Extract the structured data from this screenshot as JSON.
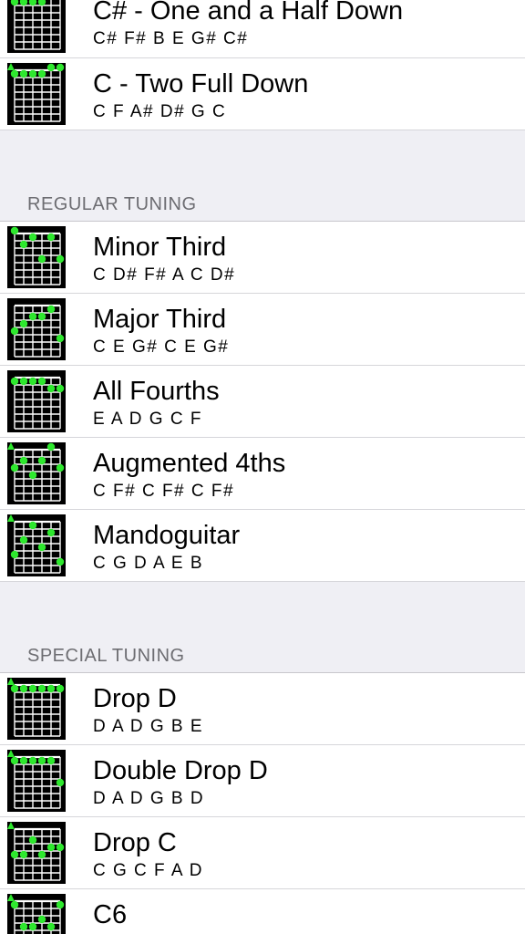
{
  "sections": [
    {
      "header": "",
      "rows": [
        {
          "name": "C# - One and a Half Down",
          "notes": "C# F# B E G# C#",
          "fret": [
            1,
            1,
            1,
            1,
            0,
            0
          ],
          "flag": "none"
        },
        {
          "name": "C - Two Full Down",
          "notes": "C F A# D# G C",
          "fret": [
            1,
            1,
            1,
            1,
            0,
            0
          ],
          "flag": "triangle"
        }
      ]
    },
    {
      "header": "REGULAR TUNING",
      "rows": [
        {
          "name": "Minor Third",
          "notes": "C D# F# A C D#",
          "fret": [
            0,
            2,
            1,
            4,
            1,
            4
          ],
          "flag": "none"
        },
        {
          "name": "Major Third",
          "notes": "C E G# C E G#",
          "fret": [
            4,
            3,
            2,
            2,
            1,
            5
          ],
          "flag": "none"
        },
        {
          "name": "All Fourths",
          "notes": "E A D G C F",
          "fret": [
            1,
            1,
            1,
            1,
            2,
            2
          ],
          "flag": "none"
        },
        {
          "name": "Augmented 4ths",
          "notes": "C F# C F# C F#",
          "fret": [
            3,
            2,
            4,
            2,
            0,
            3
          ],
          "flag": "triangle"
        },
        {
          "name": "Mandoguitar",
          "notes": "C G D A E B",
          "fret": [
            5,
            3,
            1,
            4,
            2,
            6
          ],
          "flag": "triangle"
        }
      ]
    },
    {
      "header": "SPECIAL TUNING",
      "rows": [
        {
          "name": "Drop D",
          "notes": "D A D G B E",
          "fret": [
            1,
            1,
            1,
            1,
            1,
            1
          ],
          "flag": "triangle"
        },
        {
          "name": "Double Drop D",
          "notes": "D A D G B D",
          "fret": [
            1,
            1,
            1,
            1,
            1,
            4
          ],
          "flag": "triangle"
        },
        {
          "name": "Drop C",
          "notes": "C G C F A D",
          "fret": [
            4,
            4,
            2,
            4,
            3,
            3
          ],
          "flag": "triangle"
        },
        {
          "name": "C6",
          "notes": "",
          "fret": [
            1,
            4,
            4,
            3,
            4,
            1
          ],
          "flag": "triangle"
        }
      ]
    }
  ],
  "colors": {
    "dot": "#2ee82e",
    "grid": "#ffffff",
    "board": "#000000",
    "separator": "#d6d6da",
    "header_text": "#6d6d72",
    "background": "#efeff4"
  }
}
